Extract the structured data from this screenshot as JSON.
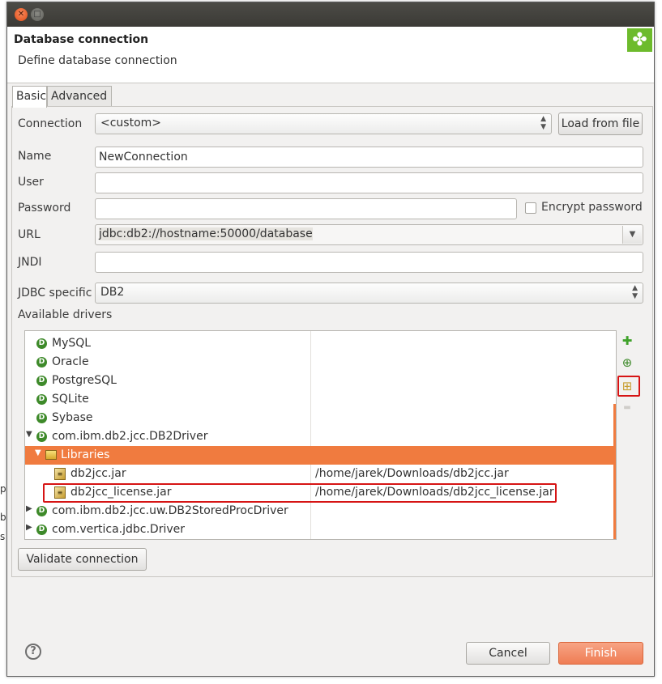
{
  "window": {
    "close_glyph": "✕",
    "max_glyph": "□"
  },
  "header": {
    "title": "Database connection",
    "subtitle": "Define database connection",
    "logo_glyph": "✤"
  },
  "tabs": [
    {
      "label": "Basic"
    },
    {
      "label": "Advanced"
    }
  ],
  "form": {
    "connection_label": "Connection",
    "connection_value": "<custom>",
    "load_from_file": "Load from file",
    "name_label": "Name",
    "name_value": "NewConnection",
    "user_label": "User",
    "user_value": "",
    "password_label": "Password",
    "password_value": "",
    "encrypt_label": "Encrypt password",
    "url_label": "URL",
    "url_value": "jdbc:db2://hostname:50000/database",
    "jndi_label": "JNDI",
    "jndi_value": "",
    "jdbc_label": "JDBC specific",
    "jdbc_value": "DB2",
    "drivers_label": "Available drivers"
  },
  "drivers": {
    "items": [
      {
        "name": "MySQL"
      },
      {
        "name": "Oracle"
      },
      {
        "name": "PostgreSQL"
      },
      {
        "name": "SQLite"
      },
      {
        "name": "Sybase"
      },
      {
        "name": "com.ibm.db2.jcc.DB2Driver"
      },
      {
        "name": "Libraries"
      },
      {
        "name": "db2jcc.jar",
        "path": "/home/jarek/Downloads/db2jcc.jar"
      },
      {
        "name": "db2jcc_license.jar",
        "path": "/home/jarek/Downloads/db2jcc_license.jar"
      },
      {
        "name": "com.ibm.db2.jcc.uw.DB2StoredProcDriver"
      },
      {
        "name": "com.vertica.jdbc.Driver"
      }
    ]
  },
  "side_tools": {
    "add_glyph": "✚",
    "add_driver_glyph": "⊕",
    "add_lib_glyph": "⊞",
    "remove_glyph": "▬"
  },
  "buttons": {
    "validate": "Validate connection",
    "cancel": "Cancel",
    "finish": "Finish",
    "help_glyph": "?"
  },
  "background_fragments": {
    "a": "p",
    "b": "b",
    "c": "s"
  },
  "colors": {
    "accent": "#f07b3f",
    "highlight": "#d61414",
    "driver_icon": "#3e8a2a"
  }
}
